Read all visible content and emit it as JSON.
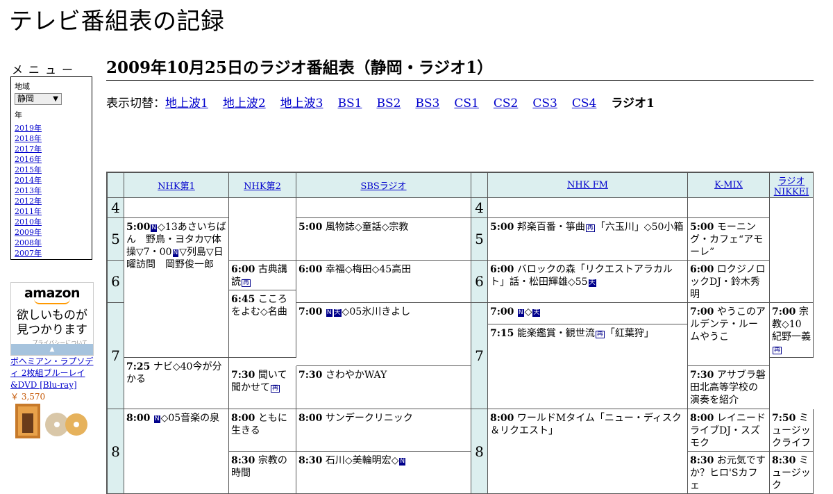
{
  "site": {
    "title": "テレビ番組表の記録"
  },
  "menu": {
    "heading": "メニュー",
    "area_label": "地域",
    "area_value": "静岡",
    "year_label": "年",
    "years": [
      "2019年",
      "2018年",
      "2017年",
      "2016年",
      "2015年",
      "2014年",
      "2013年",
      "2012年",
      "2011年",
      "2010年",
      "2009年",
      "2008年",
      "2007年"
    ]
  },
  "ad": {
    "logo": "amazon",
    "copy_line1": "欲しいものが",
    "copy_line2": "見つかります",
    "privacy": "プライバシーについて",
    "product_title": "ボヘミアン・ラプソディ 2枚組ブルーレイ&DVD [Blu-ray]",
    "price": "￥ 3,570"
  },
  "page": {
    "heading": "2009年10月25日のラジオ番組表（静岡・ラジオ1）",
    "switch_label": "表示切替：",
    "switch_links": [
      "地上波1",
      "地上波2",
      "地上波3",
      "BS1",
      "BS2",
      "BS3",
      "CS1",
      "CS2",
      "CS3",
      "CS4"
    ],
    "switch_current": "ラジオ1"
  },
  "grid": {
    "channels": [
      "NHK第1",
      "NHK第2",
      "SBSラジオ",
      "NHK FM",
      "K-MIX",
      "ラジオNIKKEI"
    ],
    "hours": [
      "4",
      "5",
      "6",
      "7",
      "8"
    ],
    "programs": {
      "nhk1_5_time": "5:00",
      "nhk1_5_a": "◇13あさいちばん　野鳥・ヨタカ▽体操▽7・00",
      "nhk1_5_b": "▽列島▽日曜訪問　岡野俊一郎",
      "nhk1_8_time": "8:00",
      "nhk1_8_text": "◇05音楽の泉",
      "nhk2_600_time": "6:00",
      "nhk2_600_text": "古典講読",
      "nhk2_645_time": "6:45",
      "nhk2_645_text": "こころをよむ◇名曲",
      "nhk2_730_time": "7:30",
      "nhk2_730_text": "聞いて聞かせて",
      "nhk2_800_time": "8:00",
      "nhk2_800_text": "ともに生きる",
      "nhk2_830_time": "8:30",
      "nhk2_830_text": "宗教の時間",
      "sbs_500_time": "5:00",
      "sbs_500_text": "風物誌◇童話◇宗教",
      "sbs_600_time": "6:00",
      "sbs_600_text": "幸福◇梅田◇45高田",
      "sbs_700_time": "7:00",
      "sbs_700_text": "◇05氷川きよし",
      "sbs_730_time": "7:30",
      "sbs_730_text": "さわやかWAY",
      "sbs_800_time": "8:00",
      "sbs_800_text": "サンデークリニック",
      "sbs_830_time": "8:30",
      "sbs_830_text": "石川◇美輪明宏◇",
      "fm_500_time": "5:00",
      "fm_500_a": "邦楽百番・箏曲",
      "fm_500_b": "「六玉川」◇50小箱",
      "fm_600_time": "6:00",
      "fm_600_text": "バロックの森「リクエストアラカルト」話・松田輝雄◇55",
      "fm_700_time": "7:00",
      "fm_700_text": "◇",
      "fm_715_time": "7:15",
      "fm_715_a": "能楽鑑賞・観世流",
      "fm_715_b": "「紅葉狩」",
      "fm_800_time": "8:00",
      "fm_800_text": "ワールドMタイム「ニュー・ディスク＆リクエスト」",
      "kmix_500_time": "5:00",
      "kmix_500_text": "モーニング・カフェ“アモーレ”",
      "kmix_600_time": "6:00",
      "kmix_600_text": "ロクジノロックDJ・鈴木秀明",
      "kmix_700_time": "7:00",
      "kmix_700_text": "やうこのアルデンテ・ルームやうこ",
      "kmix_730_time": "7:30",
      "kmix_730_text": "アサブラ磐田北高等学校の演奏を紹介",
      "kmix_800_time": "8:00",
      "kmix_800_text": "レイニードライブDJ・スズモク",
      "kmix_830_time": "8:30",
      "kmix_830_text": "お元気ですか？ヒロ'Sカフェ",
      "nk_700_time": "7:00",
      "nk_700_a": "宗教◇10紀野一義",
      "nk_725_time": "7:25",
      "nk_725_text": "ナビ◇40今が分かる",
      "nk_750_time": "7:50",
      "nk_750_text": "ミュージックライフ",
      "nk_830_time": "8:30",
      "nk_830_text": "ミュージック"
    },
    "marks": {
      "news": "N",
      "new": "新",
      "rerun": "再",
      "weather": "天"
    }
  }
}
